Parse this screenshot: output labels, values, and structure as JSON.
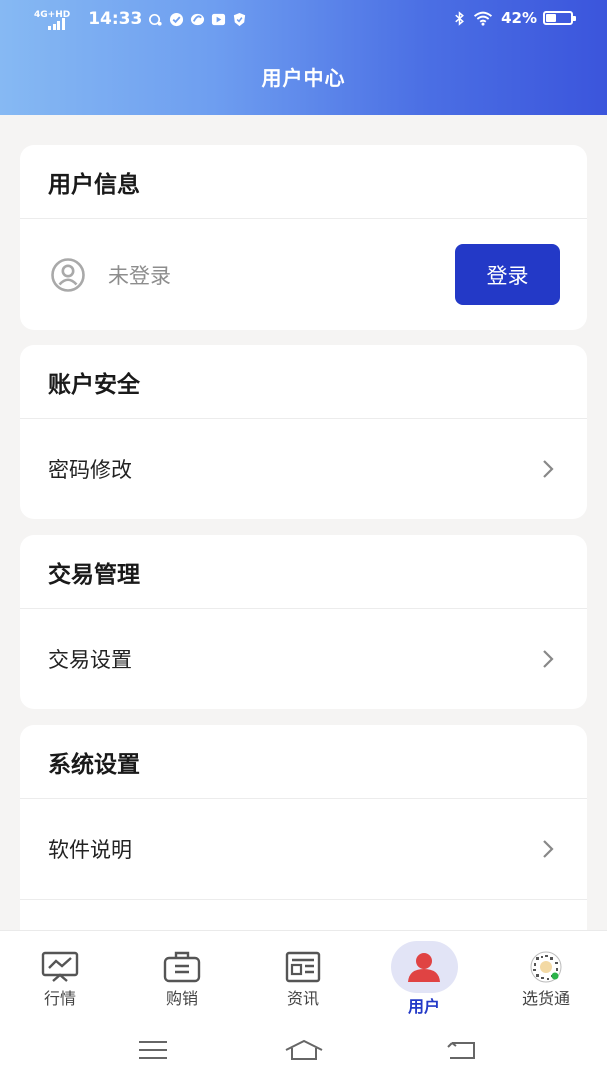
{
  "status_bar": {
    "network": "4G+HD",
    "time": "14:33",
    "battery": "42%",
    "battery_level": 0.42
  },
  "header": {
    "title": "用户中心"
  },
  "user_info": {
    "title": "用户信息",
    "status": "未登录",
    "login_label": "登录"
  },
  "account_security": {
    "title": "账户安全",
    "items": [
      {
        "label": "密码修改"
      }
    ]
  },
  "trade_management": {
    "title": "交易管理",
    "items": [
      {
        "label": "交易设置"
      }
    ]
  },
  "system_settings": {
    "title": "系统设置",
    "items": [
      {
        "label": "软件说明"
      },
      {
        "label": ""
      }
    ]
  },
  "tabbar": {
    "items": [
      {
        "label": "行情",
        "icon": "chart-icon"
      },
      {
        "label": "购销",
        "icon": "briefcase-icon"
      },
      {
        "label": "资讯",
        "icon": "news-icon"
      },
      {
        "label": "用户",
        "icon": "user-icon",
        "active": true
      },
      {
        "label": "选货通",
        "icon": "qr-code-icon"
      }
    ]
  },
  "colors": {
    "primary": "#2339c7",
    "active_tab_bg": "#e2e4f6",
    "user_icon": "#e04343",
    "header_gradient_start": "#86b9f3",
    "header_gradient_end": "#3b55dc"
  }
}
